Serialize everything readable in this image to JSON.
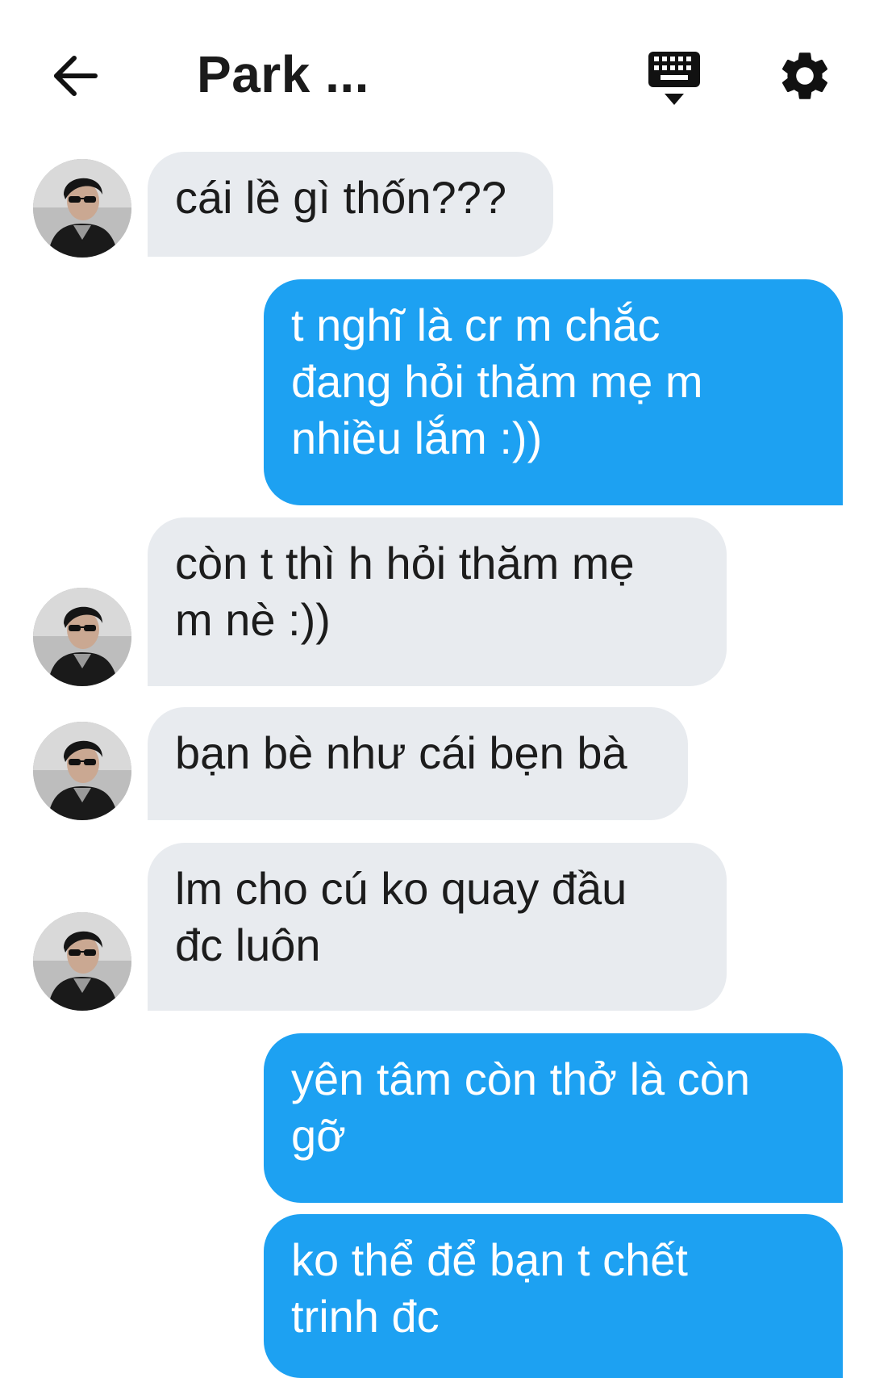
{
  "header": {
    "title": "Park ...",
    "back_icon": "arrow-left-icon",
    "keyboard_icon": "keyboard-icon",
    "settings_icon": "gear-icon"
  },
  "colors": {
    "incoming_bubble": "#e8ebef",
    "outgoing_bubble": "#1da1f2",
    "outgoing_text": "#ffffff"
  },
  "messages": [
    {
      "direction": "incoming",
      "text": "cái lề gì thốn???"
    },
    {
      "direction": "outgoing",
      "text": "t nghĩ là cr m chắc\nđang hỏi thăm mẹ m\nnhiều lắm :))"
    },
    {
      "direction": "incoming",
      "text": "còn t thì h hỏi thăm mẹ\nm nè :))"
    },
    {
      "direction": "incoming",
      "text": "bạn bè như cái bẹn bà"
    },
    {
      "direction": "incoming",
      "text": "lm cho cú ko quay đầu\nđc luôn"
    },
    {
      "direction": "outgoing",
      "text": "yên tâm còn thở là còn\ngỡ"
    },
    {
      "direction": "outgoing",
      "text": "ko thể để bạn t chết\ntrinh đc"
    }
  ]
}
